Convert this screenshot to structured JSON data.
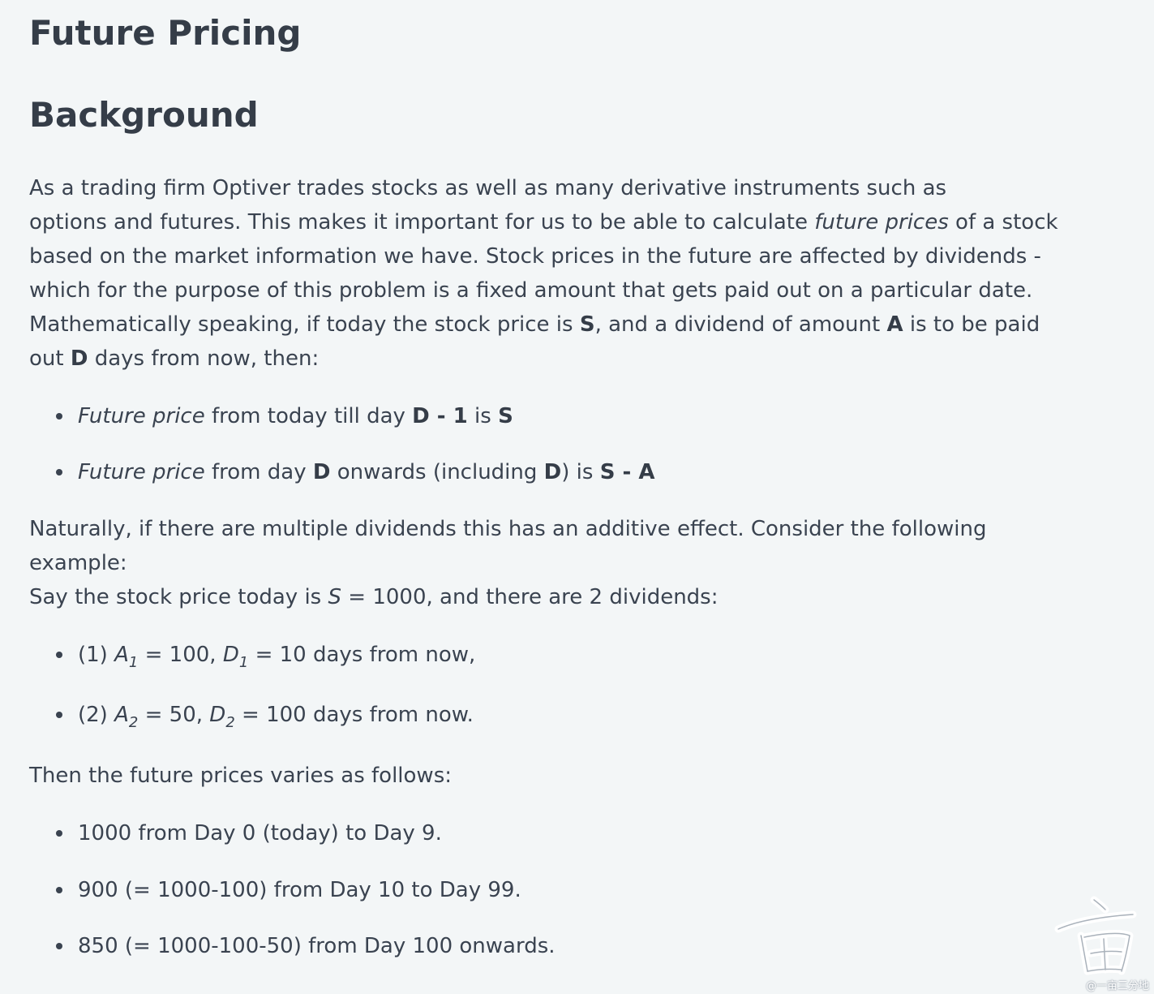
{
  "title": "Future Pricing",
  "background_heading": "Background",
  "intro": {
    "l1": "As a trading firm Optiver trades stocks as well as many derivative instruments such as",
    "l2_a": "options and futures. This makes it important for us to be able to calculate ",
    "l2_b": "future prices",
    "l2_c": " of a stock",
    "l3": "based on the market information we have. Stock prices in the future are affected by dividends -",
    "l4": "which for the purpose of this problem is a fixed amount that gets paid out on a particular date.",
    "l5_a": "Mathematically speaking, if today the stock price is ",
    "l5_b": "S",
    "l5_c": ", and a dividend of amount ",
    "l5_d": "A",
    "l5_e": " is to be paid",
    "l6_a": "out ",
    "l6_b": "D",
    "l6_c": " days from now, then:"
  },
  "rules": [
    {
      "a": "Future price",
      "b": " from today till day ",
      "c": "D - 1",
      "d": " is ",
      "e": "S"
    },
    {
      "a": "Future price",
      "b": " from day ",
      "c": "D",
      "d": " onwards (including ",
      "e": "D",
      "f": ") is ",
      "g": "S - A"
    }
  ],
  "example": {
    "l1": "Naturally, if there are multiple dividends this has an additive effect. Consider the following",
    "l2": "example:",
    "l3_a": "Say the stock price today is ",
    "l3_b": "S",
    "l3_c": " = 1000, and there are 2 dividends:"
  },
  "dividends": [
    {
      "prefix": "(1) ",
      "a": "A",
      "a_sub": "1",
      "mid": " = 100, ",
      "d": "D",
      "d_sub": "1",
      "end": " = 10 days from now,"
    },
    {
      "prefix": "(2) ",
      "a": "A",
      "a_sub": "2",
      "mid": " = 50, ",
      "d": "D",
      "d_sub": "2",
      "end": " = 100 days from now."
    }
  ],
  "then_text": "Then the future prices varies as follows:",
  "prices": [
    "1000 from Day 0 (today) to Day 9.",
    "900 (= 1000-100) from Day 10 to Day 99.",
    "850 (= 1000-100-50) from Day 100 onwards."
  ],
  "watermark_text": "@一亩三分地"
}
